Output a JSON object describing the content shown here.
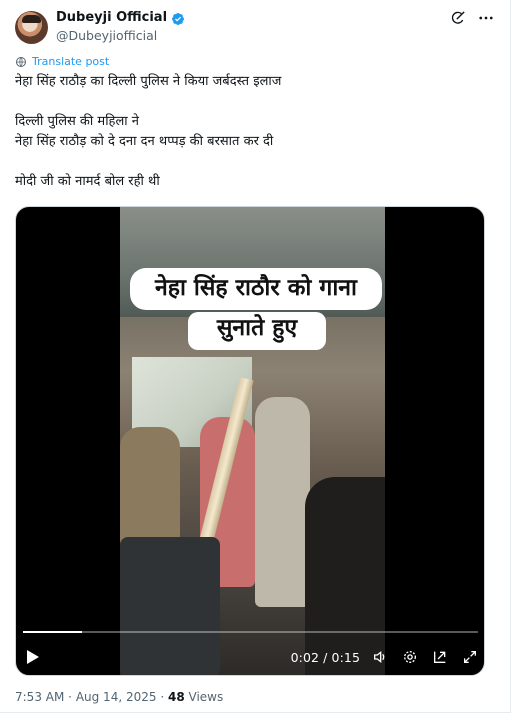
{
  "author": {
    "display_name": "Dubeyji Official",
    "handle": "@Dubeyjiofficial",
    "verified_icon": "verified-badge-icon",
    "verified_color": "#1d9bf0"
  },
  "header_actions": [
    "grok-icon",
    "more-options-icon"
  ],
  "translate": {
    "label": "Translate post",
    "icon": "translate-globe-icon",
    "color": "#1d9bf0"
  },
  "post": {
    "lines": [
      "नेहा सिंह राठौड़ का दिल्ली पुलिस ने किया जर्बदस्त इलाज",
      "दिल्ली पुलिस की महिला ने",
      "नेहा सिंह राठौड़ को दे दना दन थप्पड़ की बरसात कर  दी",
      "मोदी जी को नामर्द बोल रही थी"
    ]
  },
  "video": {
    "caption_line1": "नेहा सिंह राठौर को गाना",
    "caption_line2": "सुनाते हुए",
    "time_display": "0:02 / 0:15",
    "progress_fraction": 0.13,
    "controls": [
      "play-icon",
      "volume-icon",
      "settings-icon",
      "pop-out-icon",
      "fullscreen-icon"
    ]
  },
  "footer": {
    "time": "7:53 AM",
    "sep1": "·",
    "date": "Aug 14, 2025",
    "sep2": "·",
    "views_count": "48",
    "views_label": "Views"
  }
}
